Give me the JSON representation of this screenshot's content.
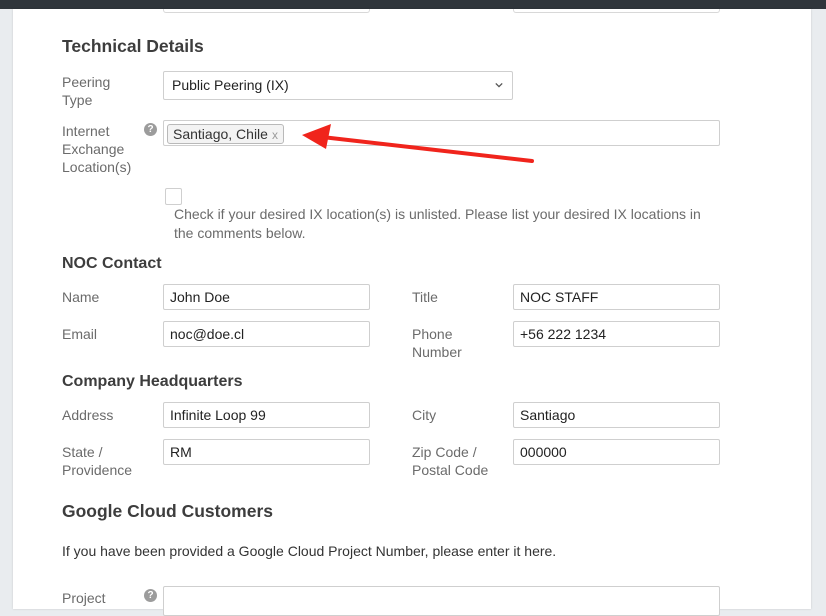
{
  "technical": {
    "heading": "Technical Details",
    "peering_type": {
      "label": "Peering Type",
      "value": "Public Peering (IX)"
    },
    "ix_location": {
      "label": "Internet Exchange Location(s)",
      "tag": "Santiago, Chile",
      "tag_remove": "x"
    },
    "unlisted_hint": "Check if your desired IX location(s) is unlisted. Please list your desired IX locations in the comments below."
  },
  "noc": {
    "heading": "NOC Contact",
    "name": {
      "label": "Name",
      "value": "John Doe"
    },
    "title": {
      "label": "Title",
      "value": "NOC STAFF"
    },
    "email": {
      "label": "Email",
      "value": "noc@doe.cl"
    },
    "phone": {
      "label": "Phone Number",
      "value": "+56 222 1234"
    }
  },
  "hq": {
    "heading": "Company Headquarters",
    "address": {
      "label": "Address",
      "value": "Infinite Loop 99"
    },
    "city": {
      "label": "City",
      "value": "Santiago"
    },
    "state": {
      "label": "State / Providence",
      "value": "RM"
    },
    "zip": {
      "label": "Zip Code / Postal Code",
      "value": "000000"
    }
  },
  "gcc": {
    "heading": "Google Cloud Customers",
    "description": "If you have been provided a Google Cloud Project Number, please enter it here.",
    "project": {
      "label": "Project"
    }
  },
  "help_glyph": "?",
  "annotation_arrow_color": "#f0241c"
}
